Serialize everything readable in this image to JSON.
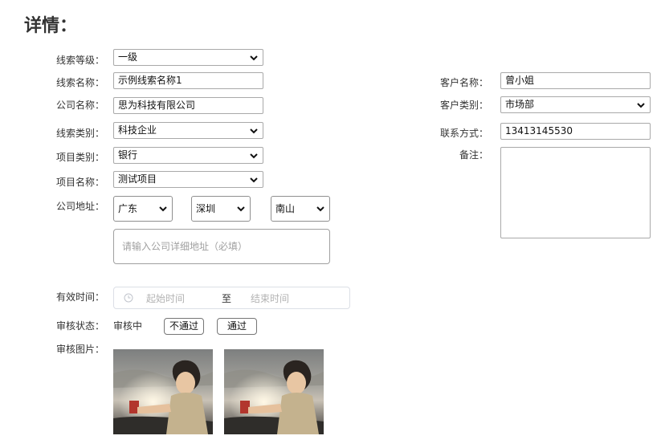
{
  "page": {
    "title": "详情："
  },
  "left": {
    "level": {
      "label": "线索等级：",
      "value": "一级"
    },
    "name": {
      "label": "线索名称：",
      "value": "示例线索名称1"
    },
    "company": {
      "label": "公司名称：",
      "value": "思为科技有限公司"
    },
    "category": {
      "label": "线索类别：",
      "value": "科技企业"
    },
    "project_type": {
      "label": "项目类别：",
      "value": "银行"
    },
    "project_name": {
      "label": "项目名称：",
      "value": "测试项目"
    },
    "address": {
      "label": "公司地址：",
      "province": "广东",
      "city": "深圳",
      "district": "南山",
      "detail_placeholder": "请输入公司详细地址（必填）"
    },
    "valid_time": {
      "label": "有效时间：",
      "start_placeholder": "起始时间",
      "separator": "至",
      "end_placeholder": "结束时间"
    },
    "review_status": {
      "label": "审核状态：",
      "value": "审核中",
      "reject_label": "不通过",
      "approve_label": "通过"
    },
    "review_images": {
      "label": "审核图片："
    }
  },
  "right": {
    "customer_name": {
      "label": "客户名称：",
      "value": "曾小姐"
    },
    "customer_type": {
      "label": "客户类别：",
      "value": "市场部"
    },
    "contact": {
      "label": "联系方式：",
      "value": "13413145530"
    },
    "remark": {
      "label": "备注：",
      "value": ""
    }
  },
  "colors": {
    "border": "#a9a9a9",
    "text": "#333333",
    "placeholder": "#b3b3b3"
  },
  "icons": {
    "select_arrow": "chevron-down-icon",
    "date": "clock-icon"
  }
}
